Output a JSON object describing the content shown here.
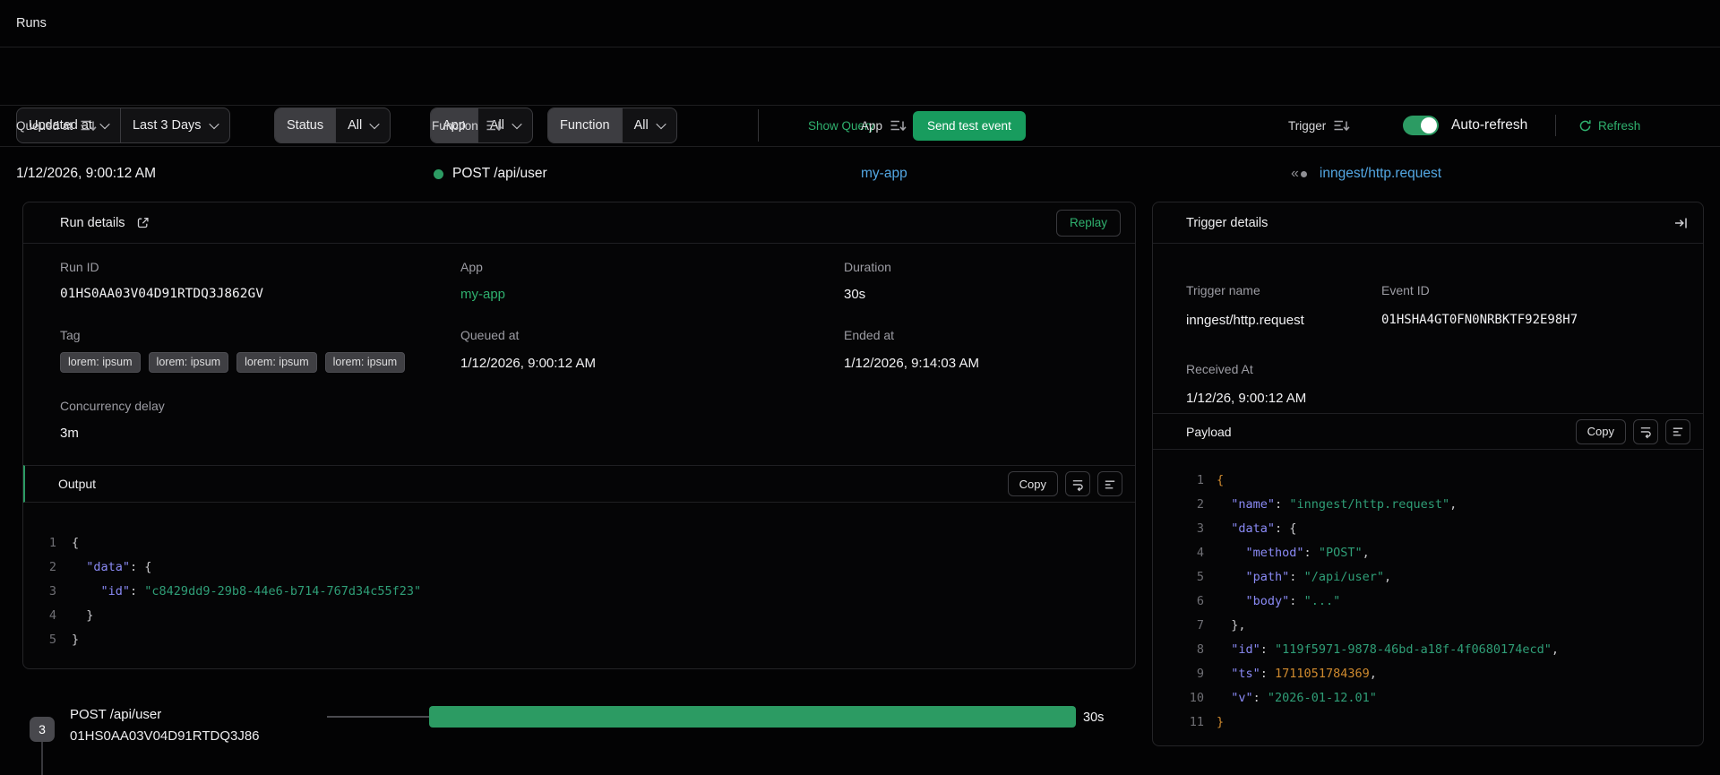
{
  "page": {
    "title": "Runs"
  },
  "filters": {
    "sort_field": {
      "value": "Updated at"
    },
    "date_range": {
      "value": "Last 3 Days"
    },
    "status": {
      "label": "Status",
      "value": "All"
    },
    "app": {
      "label": "App",
      "value": "All"
    },
    "function": {
      "label": "Function",
      "value": "All"
    },
    "show_query_label": "Show Query",
    "send_test_event_label": "Send test event",
    "auto_refresh_label": "Auto-refresh",
    "refresh_label": "Refresh"
  },
  "runs_table": {
    "columns": {
      "queued_at": "Queued at",
      "function": "Function",
      "app": "App",
      "trigger": "Trigger"
    },
    "row": {
      "queued_at": "1/12/2026, 9:00:12 AM",
      "function": "POST /api/user",
      "app": "my-app",
      "trigger": "inngest/http.request"
    }
  },
  "run_details": {
    "title": "Run details",
    "replay_label": "Replay",
    "run_id": {
      "label": "Run ID",
      "value": "01HS0AA03V04D91RTDQ3J862GV"
    },
    "app": {
      "label": "App",
      "value": "my-app"
    },
    "duration": {
      "label": "Duration",
      "value": "30s"
    },
    "tag": {
      "label": "Tag",
      "badges": [
        "lorem: ipsum",
        "lorem: ipsum",
        "lorem: ipsum",
        "lorem: ipsum"
      ]
    },
    "queued_at": {
      "label": "Queued at",
      "value": "1/12/2026, 9:00:12 AM"
    },
    "ended_at": {
      "label": "Ended at",
      "value": "1/12/2026, 9:14:03 AM"
    },
    "concurrency_delay": {
      "label": "Concurrency delay",
      "value": "3m"
    },
    "output": {
      "title": "Output",
      "copy_label": "Copy",
      "code": [
        [
          [
            "tk-p",
            "{"
          ]
        ],
        [
          [
            "tk-p",
            "  "
          ],
          [
            "tk-k",
            "\"data\""
          ],
          [
            "tk-p",
            ": {"
          ]
        ],
        [
          [
            "tk-p",
            "    "
          ],
          [
            "tk-k",
            "\"id\""
          ],
          [
            "tk-p",
            ": "
          ],
          [
            "tk-s",
            "\"c8429dd9-29b8-44e6-b714-767d34c55f23\""
          ]
        ],
        [
          [
            "tk-p",
            "  }"
          ]
        ],
        [
          [
            "tk-p",
            "}"
          ]
        ]
      ]
    }
  },
  "trigger_details": {
    "title": "Trigger details",
    "trigger_name": {
      "label": "Trigger name",
      "value": "inngest/http.request"
    },
    "event_id": {
      "label": "Event ID",
      "value": "01HSHA4GT0FN0NRBKTF92E98H7"
    },
    "received_at": {
      "label": "Received At",
      "value": "1/12/26, 9:00:12 AM"
    },
    "payload": {
      "title": "Payload",
      "copy_label": "Copy",
      "code": [
        [
          [
            "tk-o",
            "{"
          ]
        ],
        [
          [
            "tk-p",
            "  "
          ],
          [
            "tk-k",
            "\"name\""
          ],
          [
            "tk-p",
            ": "
          ],
          [
            "tk-s",
            "\"inngest/http.request\""
          ],
          [
            "tk-p",
            ","
          ]
        ],
        [
          [
            "tk-p",
            "  "
          ],
          [
            "tk-k",
            "\"data\""
          ],
          [
            "tk-p",
            ": {"
          ]
        ],
        [
          [
            "tk-p",
            "    "
          ],
          [
            "tk-k",
            "\"method\""
          ],
          [
            "tk-p",
            ": "
          ],
          [
            "tk-s",
            "\"POST\""
          ],
          [
            "tk-p",
            ","
          ]
        ],
        [
          [
            "tk-p",
            "    "
          ],
          [
            "tk-k",
            "\"path\""
          ],
          [
            "tk-p",
            ": "
          ],
          [
            "tk-s",
            "\"/api/user\""
          ],
          [
            "tk-p",
            ","
          ]
        ],
        [
          [
            "tk-p",
            "    "
          ],
          [
            "tk-k",
            "\"body\""
          ],
          [
            "tk-p",
            ": "
          ],
          [
            "tk-s",
            "\"...\""
          ]
        ],
        [
          [
            "tk-p",
            "  },"
          ]
        ],
        [
          [
            "tk-p",
            "  "
          ],
          [
            "tk-k",
            "\"id\""
          ],
          [
            "tk-p",
            ": "
          ],
          [
            "tk-s",
            "\"119f5971-9878-46bd-a18f-4f0680174ecd\""
          ],
          [
            "tk-p",
            ","
          ]
        ],
        [
          [
            "tk-p",
            "  "
          ],
          [
            "tk-k",
            "\"ts\""
          ],
          [
            "tk-p",
            ": "
          ],
          [
            "tk-n",
            "1711051784369"
          ],
          [
            "tk-p",
            ","
          ]
        ],
        [
          [
            "tk-p",
            "  "
          ],
          [
            "tk-k",
            "\"v\""
          ],
          [
            "tk-p",
            ": "
          ],
          [
            "tk-s",
            "\"2026-01-12.01\""
          ]
        ],
        [
          [
            "tk-o",
            "}"
          ]
        ]
      ]
    }
  },
  "timeline": {
    "step_count": "3",
    "function_name": "POST /api/user",
    "run_id": "01HS0AA03V04D91RTDQ3J86",
    "duration": "30s"
  },
  "colors": {
    "accent_green": "#2fb06e",
    "button_green": "#189c5e",
    "bar_green": "#2c9b63",
    "link_blue": "#53a7e3"
  }
}
